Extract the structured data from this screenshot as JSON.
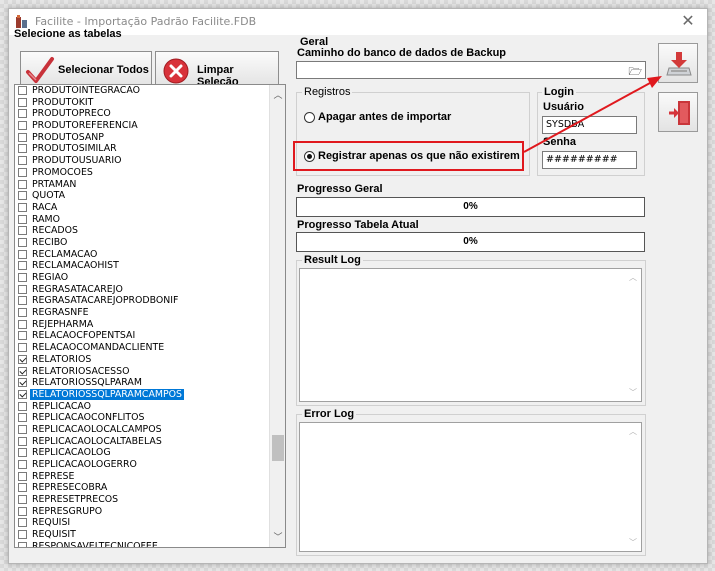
{
  "window": {
    "title": "Facilite - Importação Padrão Facilite.FDB",
    "close_glyph": "✕"
  },
  "left": {
    "label": "Selecione as tabelas",
    "select_all_label": "Selecionar Todos",
    "clear_label": "Limpar Seleção",
    "tables": [
      {
        "name": "PRODUTOINTEGRACAO",
        "checked": false
      },
      {
        "name": "PRODUTOKIT",
        "checked": false
      },
      {
        "name": "PRODUTOPRECO",
        "checked": false
      },
      {
        "name": "PRODUTOREFERENCIA",
        "checked": false
      },
      {
        "name": "PRODUTOSANP",
        "checked": false
      },
      {
        "name": "PRODUTOSIMILAR",
        "checked": false
      },
      {
        "name": "PRODUTOUSUARIO",
        "checked": false
      },
      {
        "name": "PROMOCOES",
        "checked": false
      },
      {
        "name": "PRTAMAN",
        "checked": false
      },
      {
        "name": "QUOTA",
        "checked": false
      },
      {
        "name": "RACA",
        "checked": false
      },
      {
        "name": "RAMO",
        "checked": false
      },
      {
        "name": "RECADOS",
        "checked": false
      },
      {
        "name": "RECIBO",
        "checked": false
      },
      {
        "name": "RECLAMACAO",
        "checked": false
      },
      {
        "name": "RECLAMACAOHIST",
        "checked": false
      },
      {
        "name": "REGIAO",
        "checked": false
      },
      {
        "name": "REGRASATACAREJO",
        "checked": false
      },
      {
        "name": "REGRASATACAREJOPRODBONIF",
        "checked": false
      },
      {
        "name": "REGRASNFE",
        "checked": false
      },
      {
        "name": "REJEPHARMA",
        "checked": false
      },
      {
        "name": "RELACAOCFOPENTSAI",
        "checked": false
      },
      {
        "name": "RELACAOCOMANDACLIENTE",
        "checked": false
      },
      {
        "name": "RELATORIOS",
        "checked": true
      },
      {
        "name": "RELATORIOSACESSO",
        "checked": true
      },
      {
        "name": "RELATORIOSSQLPARAM",
        "checked": true
      },
      {
        "name": "RELATORIOSSQLPARAMCAMPOS",
        "checked": true,
        "selected": true
      },
      {
        "name": "REPLICACAO",
        "checked": false
      },
      {
        "name": "REPLICACAOCONFLITOS",
        "checked": false
      },
      {
        "name": "REPLICACAOLOCALCAMPOS",
        "checked": false
      },
      {
        "name": "REPLICACAOLOCALTABELAS",
        "checked": false
      },
      {
        "name": "REPLICACAOLOG",
        "checked": false
      },
      {
        "name": "REPLICACAOLOGERRO",
        "checked": false
      },
      {
        "name": "REPRESE",
        "checked": false
      },
      {
        "name": "REPRESECOBRA",
        "checked": false
      },
      {
        "name": "REPRESETPRECOS",
        "checked": false
      },
      {
        "name": "REPRESGRUPO",
        "checked": false
      },
      {
        "name": "REQUISI",
        "checked": false
      },
      {
        "name": "REQUISIT",
        "checked": false
      },
      {
        "name": "RESPONSAVELTECNICOFEE",
        "checked": false
      }
    ]
  },
  "geral": {
    "title": "Geral",
    "backup_path_label": "Caminho do banco de dados de Backup",
    "backup_path_value": "",
    "browse_glyph": "🗁"
  },
  "registros": {
    "title": "Registros",
    "option_delete": "Apagar antes de importar",
    "option_register_missing": "Registrar apenas os que não existirem",
    "selected": "option_register_missing"
  },
  "login": {
    "title": "Login",
    "user_label": "Usuário",
    "user_value": "SYSDBA",
    "password_label": "Senha",
    "password_value": "#########"
  },
  "progress": {
    "general_label": "Progresso Geral",
    "general_value": "0%",
    "current_label": "Progresso Tabela Atual",
    "current_value": "0%"
  },
  "logs": {
    "result_label": "Result Log",
    "error_label": "Error Log"
  },
  "colors": {
    "selection": "#0078d7",
    "highlight": "#e0191e"
  }
}
